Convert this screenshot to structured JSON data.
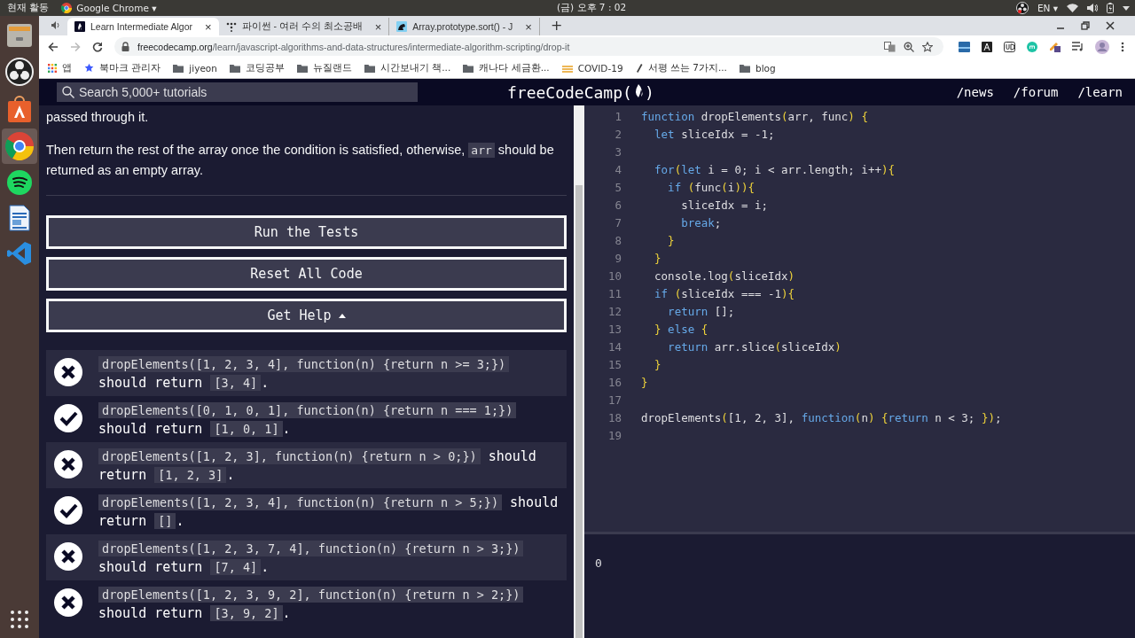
{
  "system_bar": {
    "activities": "현재 활동",
    "app_menu": "Google Chrome ▾",
    "clock": "(금) 오후 7 : 02",
    "language": "EN ▾"
  },
  "tabs": [
    {
      "title": "Learn Intermediate Algor",
      "close": "×",
      "selected": true,
      "kind": "fcc"
    },
    {
      "title": "파이썬 - 여러 수의 최소공배",
      "close": "×",
      "selected": false,
      "kind": "dots"
    },
    {
      "title": "Array.prototype.sort() - J",
      "close": "×",
      "selected": false,
      "kind": "mdn"
    }
  ],
  "new_tab": "+",
  "address": {
    "host": "freecodecamp.org",
    "path": "/learn/javascript-algorithms-and-data-structures/intermediate-algorithm-scripting/drop-it"
  },
  "bookmarks": [
    {
      "kind": "apps",
      "label": "앱"
    },
    {
      "kind": "star",
      "label": "북마크 관리자"
    },
    {
      "kind": "folder",
      "label": "jiyeon"
    },
    {
      "kind": "folder",
      "label": "코딩공부"
    },
    {
      "kind": "folder",
      "label": "뉴질랜드"
    },
    {
      "kind": "folder",
      "label": "시간보내기 책..."
    },
    {
      "kind": "folder",
      "label": "캐나다 세금환..."
    },
    {
      "kind": "page",
      "label": "COVID-19"
    },
    {
      "kind": "pen",
      "label": "서평 쓰는 7가지..."
    },
    {
      "kind": "folder",
      "label": "blog"
    }
  ],
  "navbar": {
    "search": {
      "placeholder": "Search 5,000+ tutorials"
    },
    "logo": {
      "before": "freeCodeCamp(",
      "after": ")"
    },
    "links": [
      "/news",
      "/forum",
      "/learn"
    ]
  },
  "description": [
    {
      "parts": [
        {
          "kind": "text",
          "text": "passed through it."
        }
      ]
    },
    {
      "parts": [
        {
          "kind": "text",
          "text": "Then return the rest of the array once the condition is satisfied, otherwise, "
        },
        {
          "kind": "code",
          "text": "arr"
        },
        {
          "kind": "text",
          "text": " should be returned as an empty array."
        }
      ]
    }
  ],
  "buttons": [
    {
      "label": "Run the Tests",
      "caret": false
    },
    {
      "label": "Reset All Code",
      "caret": false
    },
    {
      "label": "Get Help",
      "caret": true
    }
  ],
  "tests": [
    {
      "passed": false,
      "parts": [
        {
          "kind": "code",
          "text": "dropElements([1, 2, 3, 4], function(n) {return n >= 3;})"
        },
        {
          "kind": "text",
          "text": " should return "
        },
        {
          "kind": "code",
          "text": "[3, 4]"
        },
        {
          "kind": "text",
          "text": "."
        }
      ]
    },
    {
      "passed": true,
      "parts": [
        {
          "kind": "code",
          "text": "dropElements([0, 1, 0, 1], function(n) {return n === 1;})"
        },
        {
          "kind": "text",
          "text": " should return "
        },
        {
          "kind": "code",
          "text": "[1, 0, 1]"
        },
        {
          "kind": "text",
          "text": "."
        }
      ]
    },
    {
      "passed": false,
      "parts": [
        {
          "kind": "code",
          "text": "dropElements([1, 2, 3], function(n) {return n > 0;})"
        },
        {
          "kind": "text",
          "text": " should return "
        },
        {
          "kind": "code",
          "text": "[1, 2, 3]"
        },
        {
          "kind": "text",
          "text": "."
        }
      ]
    },
    {
      "passed": true,
      "parts": [
        {
          "kind": "code",
          "text": "dropElements([1, 2, 3, 4], function(n) {return n > 5;})"
        },
        {
          "kind": "text",
          "text": " should return "
        },
        {
          "kind": "code",
          "text": "[]"
        },
        {
          "kind": "text",
          "text": "."
        }
      ]
    },
    {
      "passed": false,
      "parts": [
        {
          "kind": "code",
          "text": "dropElements([1, 2, 3, 7, 4], function(n) {return n > 3;})"
        },
        {
          "kind": "text",
          "text": " should return "
        },
        {
          "kind": "code",
          "text": "[7, 4]"
        },
        {
          "kind": "text",
          "text": "."
        }
      ]
    },
    {
      "passed": false,
      "parts": [
        {
          "kind": "code",
          "text": "dropElements([1, 2, 3, 9, 2], function(n) {return n > 2;})"
        },
        {
          "kind": "text",
          "text": " should return "
        },
        {
          "kind": "code",
          "text": "[3, 9, 2]"
        },
        {
          "kind": "text",
          "text": "."
        }
      ]
    }
  ],
  "editor": {
    "lines": [
      {
        "number": "1",
        "tokens": [
          {
            "kind": "kw",
            "text": "function"
          },
          {
            "kind": "tx",
            "text": " dropElements"
          },
          {
            "kind": "br",
            "text": "("
          },
          {
            "kind": "tx",
            "text": "arr, func"
          },
          {
            "kind": "br",
            "text": ") {"
          }
        ]
      },
      {
        "number": "2",
        "tokens": [
          {
            "kind": "kw",
            "text": "  let"
          },
          {
            "kind": "tx",
            "text": " sliceIdx = -1;"
          }
        ]
      },
      {
        "number": "3"
      },
      {
        "number": "4",
        "tokens": [
          {
            "kind": "kw",
            "text": "  for"
          },
          {
            "kind": "br",
            "text": "("
          },
          {
            "kind": "kw",
            "text": "let"
          },
          {
            "kind": "tx",
            "text": " i = 0; i < arr.length; i++"
          },
          {
            "kind": "br",
            "text": "){"
          }
        ]
      },
      {
        "number": "5",
        "tokens": [
          {
            "kind": "kw",
            "text": "    if"
          },
          {
            "kind": "br",
            "text": " ("
          },
          {
            "kind": "tx",
            "text": "func"
          },
          {
            "kind": "br",
            "text": "("
          },
          {
            "kind": "tx",
            "text": "i"
          },
          {
            "kind": "br",
            "text": ")){"
          }
        ]
      },
      {
        "number": "6",
        "tokens": [
          {
            "kind": "tx",
            "text": "      sliceIdx = i;"
          }
        ]
      },
      {
        "number": "7",
        "tokens": [
          {
            "kind": "kw",
            "text": "      break"
          },
          {
            "kind": "tx",
            "text": ";"
          }
        ]
      },
      {
        "number": "8",
        "tokens": [
          {
            "kind": "br",
            "text": "    }"
          }
        ]
      },
      {
        "number": "9",
        "tokens": [
          {
            "kind": "br",
            "text": "  }"
          }
        ]
      },
      {
        "number": "10",
        "tokens": [
          {
            "kind": "tx",
            "text": "  console.log"
          },
          {
            "kind": "br",
            "text": "("
          },
          {
            "kind": "tx",
            "text": "sliceIdx"
          },
          {
            "kind": "br",
            "text": ")"
          }
        ]
      },
      {
        "number": "11",
        "tokens": [
          {
            "kind": "kw",
            "text": "  if"
          },
          {
            "kind": "br",
            "text": " ("
          },
          {
            "kind": "tx",
            "text": "sliceIdx === -1"
          },
          {
            "kind": "br",
            "text": "){"
          }
        ]
      },
      {
        "number": "12",
        "tokens": [
          {
            "kind": "kw",
            "text": "    return"
          },
          {
            "kind": "tx",
            "text": " [];"
          }
        ]
      },
      {
        "number": "13",
        "tokens": [
          {
            "kind": "br",
            "text": "  }"
          },
          {
            "kind": "kw",
            "text": " else"
          },
          {
            "kind": "br",
            "text": " {"
          }
        ]
      },
      {
        "number": "14",
        "tokens": [
          {
            "kind": "kw",
            "text": "    return"
          },
          {
            "kind": "tx",
            "text": " arr.slice"
          },
          {
            "kind": "br",
            "text": "("
          },
          {
            "kind": "tx",
            "text": "sliceIdx"
          },
          {
            "kind": "br",
            "text": ")"
          }
        ]
      },
      {
        "number": "15",
        "tokens": [
          {
            "kind": "br",
            "text": "  }"
          }
        ]
      },
      {
        "number": "16",
        "tokens": [
          {
            "kind": "br",
            "text": "}"
          }
        ]
      },
      {
        "number": "17"
      },
      {
        "number": "18",
        "tokens": [
          {
            "kind": "tx",
            "text": "dropElements"
          },
          {
            "kind": "br",
            "text": "("
          },
          {
            "kind": "tx",
            "text": "[1, 2, 3], "
          },
          {
            "kind": "kw",
            "text": "function"
          },
          {
            "kind": "br",
            "text": "("
          },
          {
            "kind": "tx",
            "text": "n"
          },
          {
            "kind": "br",
            "text": ") {"
          },
          {
            "kind": "kw",
            "text": "return"
          },
          {
            "kind": "tx",
            "text": " n < 3; "
          },
          {
            "kind": "br",
            "text": "})"
          },
          {
            "kind": "tx",
            "text": ";"
          }
        ]
      },
      {
        "number": "19"
      }
    ]
  },
  "console": {
    "output": "0"
  }
}
